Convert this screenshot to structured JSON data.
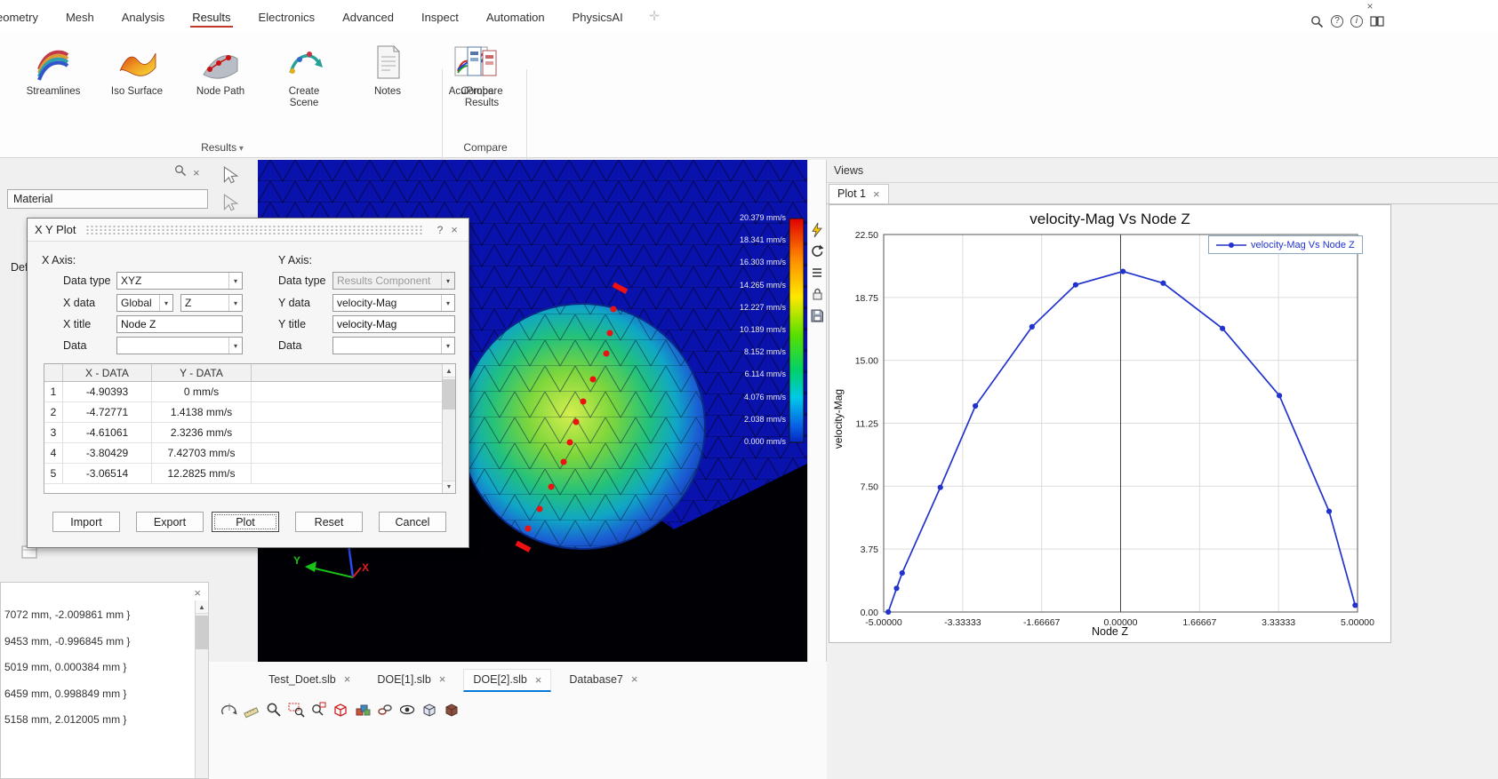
{
  "menubar": {
    "items": [
      "eometry",
      "Mesh",
      "Analysis",
      "Results",
      "Electronics",
      "Advanced",
      "Inspect",
      "Automation",
      "PhysicsAI"
    ]
  },
  "ribbon": {
    "groups": [
      {
        "label": "Results",
        "buttons": [
          {
            "label": "Streamlines"
          },
          {
            "label": "Iso Surface"
          },
          {
            "label": "Node Path"
          },
          {
            "label": "Create Scene"
          },
          {
            "label": "Notes"
          },
          {
            "label": "AcuProbe"
          }
        ]
      },
      {
        "label": "Compare",
        "buttons": [
          {
            "label": "Compare Results"
          }
        ]
      }
    ]
  },
  "left_panel": {
    "material_label": "Material",
    "def_label": "Def",
    "coords_list": [
      "7072 mm, -2.009861 mm }",
      "9453 mm, -0.996845 mm }",
      "5019 mm, 0.000384 mm }",
      "6459 mm, 0.998849 mm }",
      "5158 mm, 2.012005 mm }"
    ]
  },
  "viewport": {
    "legend_labels": [
      "20.379 mm/s",
      "18.341 mm/s",
      "16.303 mm/s",
      "14.265 mm/s",
      "12.227 mm/s",
      "10.189 mm/s",
      "8.152 mm/s",
      "6.114 mm/s",
      "4.076 mm/s",
      "2.038 mm/s",
      "0.000 mm/s"
    ],
    "triad": {
      "x_label": "X",
      "y_label": "Y"
    }
  },
  "views_panel": {
    "title": "Views",
    "tabs": [
      {
        "label": "Plot 1"
      }
    ]
  },
  "chart_data": {
    "type": "line",
    "title": "velocity-Mag Vs Node Z",
    "xlabel": "Node Z",
    "ylabel": "velocity-Mag",
    "xlim": [
      -5,
      5
    ],
    "ylim": [
      0,
      22.5
    ],
    "xticks": [
      "-5.00000",
      "-3.33333",
      "-1.66667",
      "0.00000",
      "1.66667",
      "3.33333",
      "5.00000"
    ],
    "yticks": [
      "0.00",
      "3.75",
      "7.50",
      "11.25",
      "15.00",
      "18.75",
      "22.50"
    ],
    "grid": true,
    "legend": [
      "velocity-Mag Vs Node Z"
    ],
    "legend_position": "top-right",
    "series": [
      {
        "name": "velocity-Mag Vs Node Z",
        "color": "#2233cc",
        "x": [
          -4.90393,
          -4.72771,
          -4.61061,
          -3.80429,
          -3.06514,
          -1.87,
          -0.95,
          0.05,
          0.9,
          2.15,
          3.35,
          4.4,
          4.95
        ],
        "y": [
          0,
          1.4138,
          2.3236,
          7.42703,
          12.2825,
          17.0,
          19.5,
          20.3,
          19.6,
          16.9,
          12.9,
          6.0,
          0.4
        ]
      }
    ]
  },
  "dialog": {
    "title": "X Y Plot",
    "x_axis_heading": "X Axis:",
    "y_axis_heading": "Y Axis:",
    "labels": {
      "data_type": "Data type",
      "x_data": "X data",
      "x_title": "X title",
      "data": "Data",
      "y_data": "Y data",
      "y_title": "Y title"
    },
    "values": {
      "x_data_type": "XYZ",
      "x_data_global": "Global",
      "x_data_axis": "Z",
      "x_title": "Node Z",
      "y_data_type": "Results Component",
      "y_data": "velocity-Mag",
      "y_title": "velocity-Mag"
    },
    "table": {
      "col_x": "X - DATA",
      "col_y": "Y - DATA",
      "rows": [
        {
          "n": "1",
          "x": "-4.90393",
          "y": "0 mm/s"
        },
        {
          "n": "2",
          "x": "-4.72771",
          "y": "1.4138 mm/s"
        },
        {
          "n": "3",
          "x": "-4.61061",
          "y": "2.3236 mm/s"
        },
        {
          "n": "4",
          "x": "-3.80429",
          "y": "7.42703 mm/s"
        },
        {
          "n": "5",
          "x": "-3.06514",
          "y": "12.2825 mm/s"
        }
      ]
    },
    "buttons": {
      "import": "Import",
      "export": "Export",
      "plot": "Plot",
      "reset": "Reset",
      "cancel": "Cancel"
    }
  },
  "doc_tabs": [
    "Test_Doet.slb",
    "DOE[1].slb",
    "DOE[2].slb",
    "Database7"
  ]
}
